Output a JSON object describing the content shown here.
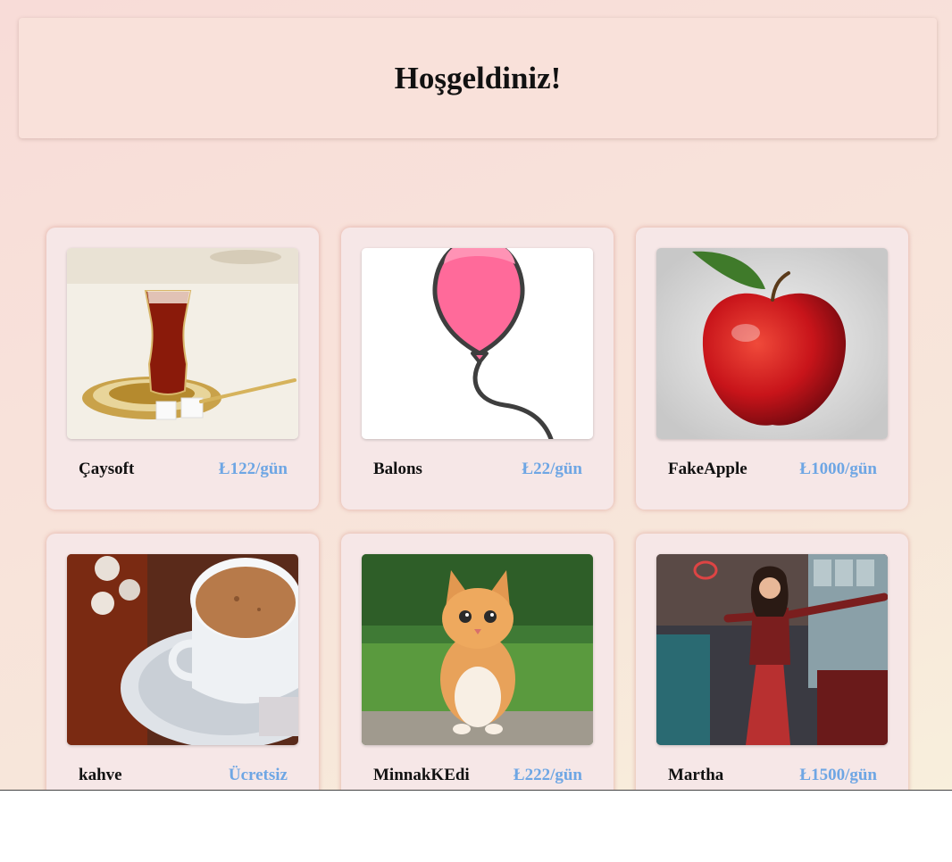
{
  "header": {
    "title": "Hoşgeldiniz!"
  },
  "products": [
    {
      "name": "Çaysoft",
      "price": "Ł122/gün",
      "image": "turkish-tea-glass"
    },
    {
      "name": "Balons",
      "price": "Ł22/gün",
      "image": "pink-balloon"
    },
    {
      "name": "FakeApple",
      "price": "Ł1000/gün",
      "image": "red-apple"
    },
    {
      "name": "kahve",
      "price": "Ücretsiz",
      "image": "turkish-coffee-cup"
    },
    {
      "name": "MinnakKEdi",
      "price": "Ł222/gün",
      "image": "orange-kitten"
    },
    {
      "name": "Martha",
      "price": "Ł1500/gün",
      "image": "woman-in-red-dress"
    }
  ],
  "colors": {
    "price": "#6ea6e4",
    "card": "#f6e7e7",
    "header": "#f9e1da"
  }
}
